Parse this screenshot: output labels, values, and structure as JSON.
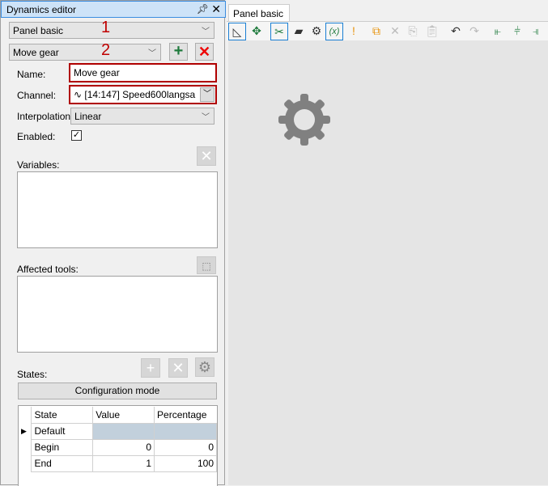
{
  "editor": {
    "title": "Dynamics editor",
    "panel_combo": "Panel basic",
    "dynamic_combo": "Move gear",
    "marker1": "1",
    "marker2": "2",
    "name_label": "Name:",
    "name_value": "Move gear",
    "channel_label": "Channel:",
    "channel_value": "[14:147] Speed600langsa",
    "interp_label": "Interpolation:",
    "interp_value": "Linear",
    "enabled_label": "Enabled:",
    "enabled": true,
    "variables_label": "Variables:",
    "affected_label": "Affected tools:",
    "states_label": "States:",
    "config_button": "Configuration mode",
    "grid": {
      "headers": [
        "State",
        "Value",
        "Percentage"
      ],
      "rows": [
        {
          "state": "Default",
          "value": "",
          "percentage": ""
        },
        {
          "state": "Begin",
          "value": "0",
          "percentage": "0"
        },
        {
          "state": "End",
          "value": "1",
          "percentage": "100"
        }
      ]
    }
  },
  "document": {
    "tab": "Panel basic"
  },
  "colors": {
    "accent": "#1a7fd4",
    "highlight": "#c00000",
    "add": "#1e7a3c",
    "canvas": "#e5e5e5"
  }
}
